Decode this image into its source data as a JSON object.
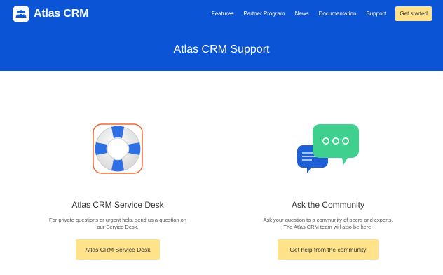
{
  "header": {
    "logo_text": "Atlas CRM",
    "logo_icon": "team-icon",
    "title": "Atlas CRM Support",
    "background_color": "#0b54d6",
    "nav": [
      {
        "label": "Features"
      },
      {
        "label": "Partner Program"
      },
      {
        "label": "News"
      },
      {
        "label": "Documentation"
      },
      {
        "label": "Support"
      }
    ],
    "cta_label": "Get started",
    "cta_color": "#ffe28a"
  },
  "cards": {
    "service_desk": {
      "icon": "lifebuoy-icon",
      "title": "Atlas CRM Service Desk",
      "description_lines": [
        "For private questions or urgent help, send us a question on",
        "our Service Desk."
      ],
      "button_label": "Atlas CRM Service Desk"
    },
    "community": {
      "icon": "chat-bubbles-icon",
      "title": "Ask the Community",
      "description_lines": [
        "Ask your question to a community of peers and experts.",
        "The Atlas CRM team will also be here."
      ],
      "button_label": "Get help from the community"
    }
  }
}
